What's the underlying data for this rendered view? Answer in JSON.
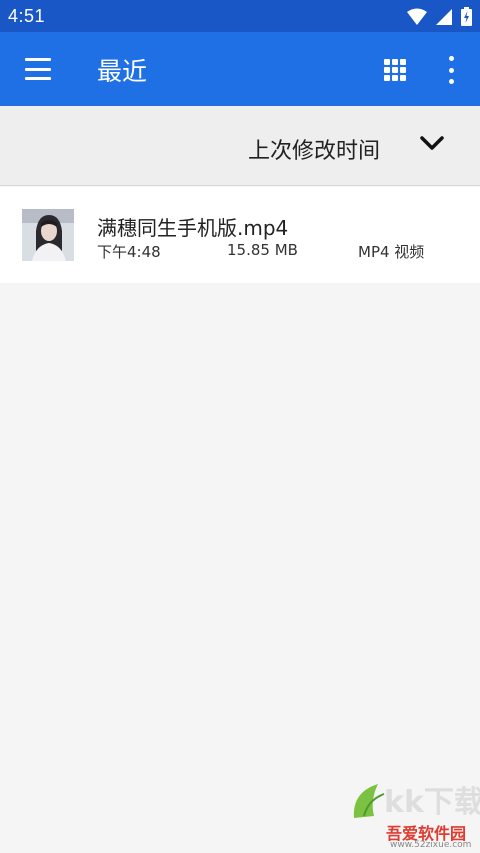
{
  "status_bar": {
    "time": "4:51"
  },
  "app_bar": {
    "title": "最近"
  },
  "sort": {
    "label": "上次修改时间"
  },
  "files": [
    {
      "name": "满穗同生手机版.mp4",
      "time": "下午4:48",
      "size": "15.85 MB",
      "type": "MP4 视频"
    }
  ],
  "watermark": {
    "text": "吾爱软件园",
    "url": "www.52zixue.com",
    "logo": "kk下载"
  },
  "colors": {
    "status_bar": "#1a57c6",
    "app_bar": "#1f6fe5",
    "background": "#f5f5f5",
    "sort_bar": "#eeeeee"
  }
}
